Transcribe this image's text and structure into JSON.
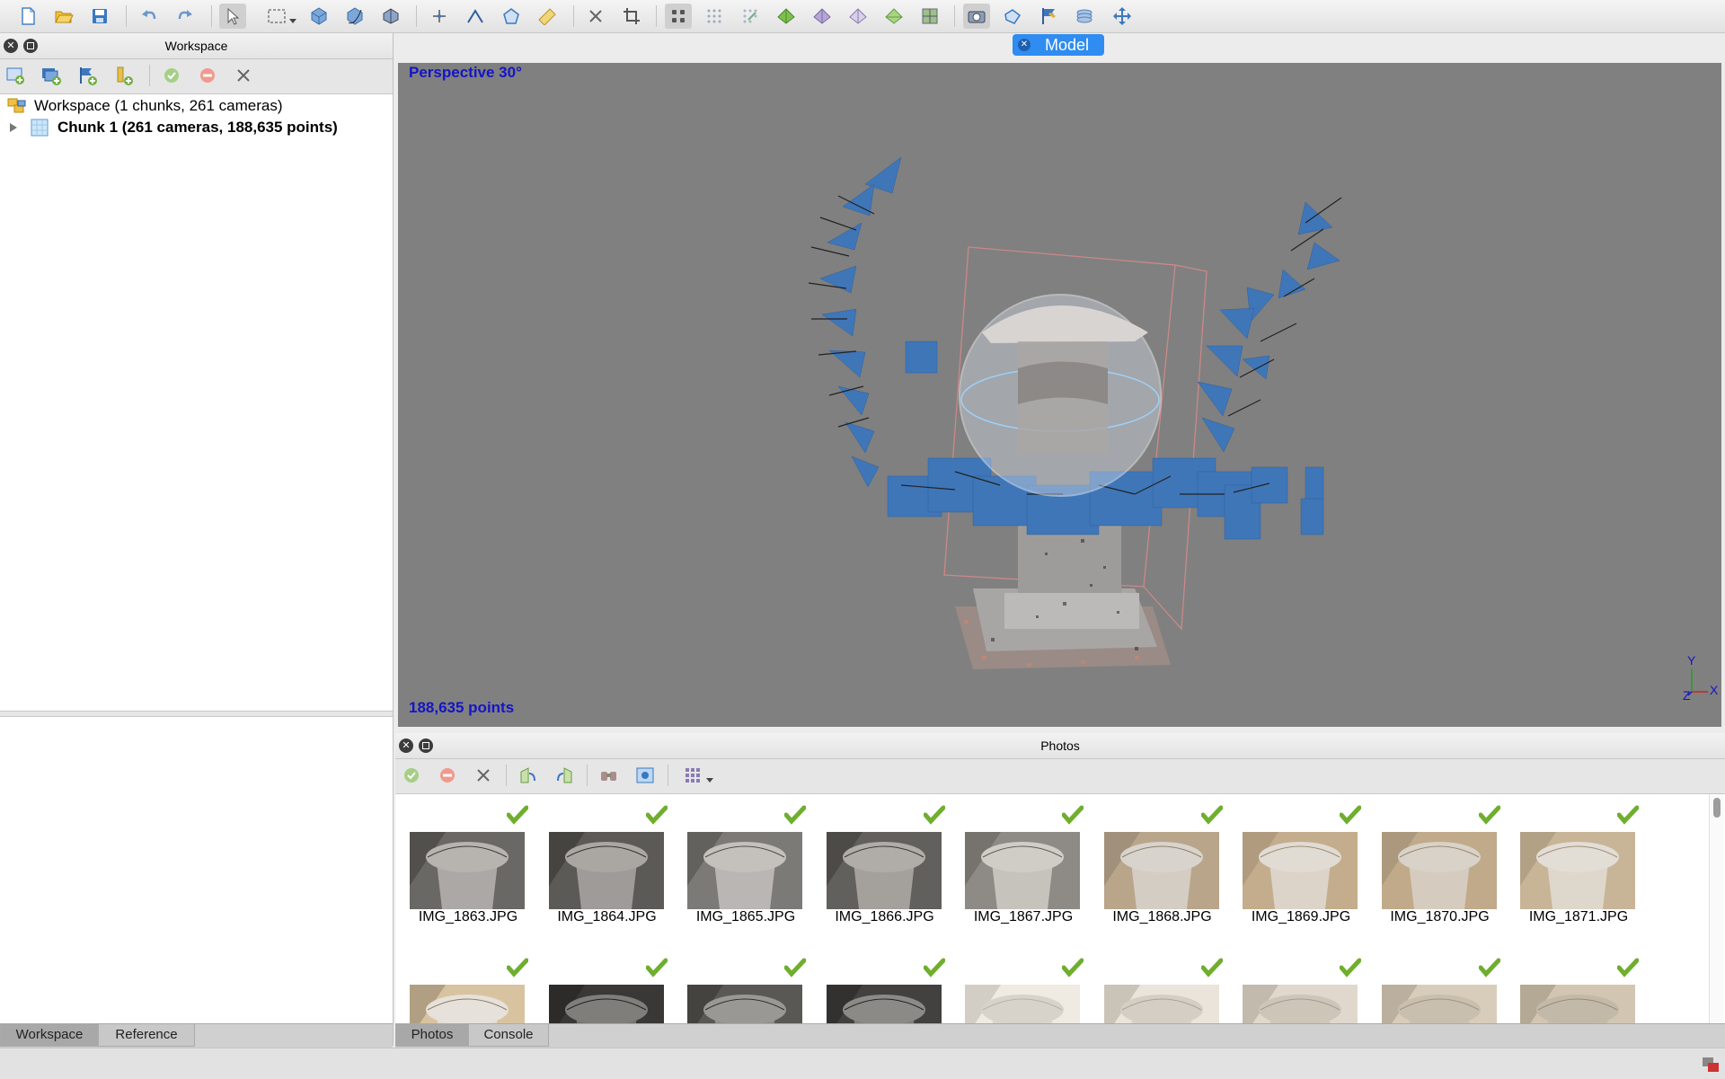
{
  "toolbar": {
    "icons": [
      "new-icon",
      "open-icon",
      "save-icon",
      "undo-icon",
      "redo-icon",
      "navigation-icon",
      "rectangle-selection-icon",
      "resize-region-icon",
      "rotate-region-icon",
      "rotate-object-icon",
      "draw-point-icon",
      "draw-polyline-icon",
      "draw-polygon-icon",
      "ruler-icon",
      "delete-icon",
      "crop-icon",
      "point-cloud-icon",
      "dense-cloud-icon",
      "dense-cloud-classes-icon",
      "model-solid-icon",
      "model-wireframe-icon",
      "model-shaded-icon",
      "model-textured-icon",
      "tiled-model-icon",
      "show-cameras-icon",
      "show-shapes-icon",
      "show-markers-icon",
      "show-region-icon",
      "reset-view-icon"
    ]
  },
  "workspace": {
    "title": "Workspace",
    "root_label": "Workspace (1 chunks, 261 cameras)",
    "chunk_label": "Chunk 1 (261 cameras, 188,635 points)",
    "tabs": [
      "Workspace",
      "Reference"
    ]
  },
  "model": {
    "tab_label": "Model",
    "view_label": "Perspective 30°",
    "points_label": "188,635 points",
    "axis_labels": {
      "y": "Y",
      "z": "Z",
      "x": "X"
    },
    "colors": {
      "background": "#808080",
      "cameras": "#3f76b8",
      "overlay_text": "#1414c8"
    }
  },
  "photos": {
    "title": "Photos",
    "row1": [
      {
        "name": "IMG_1863.JPG"
      },
      {
        "name": "IMG_1864.JPG"
      },
      {
        "name": "IMG_1865.JPG"
      },
      {
        "name": "IMG_1866.JPG"
      },
      {
        "name": "IMG_1867.JPG"
      },
      {
        "name": "IMG_1868.JPG"
      },
      {
        "name": "IMG_1869.JPG"
      },
      {
        "name": "IMG_1870.JPG"
      },
      {
        "name": "IMG_1871.JPG"
      }
    ],
    "tabs": [
      "Photos",
      "Console"
    ]
  }
}
